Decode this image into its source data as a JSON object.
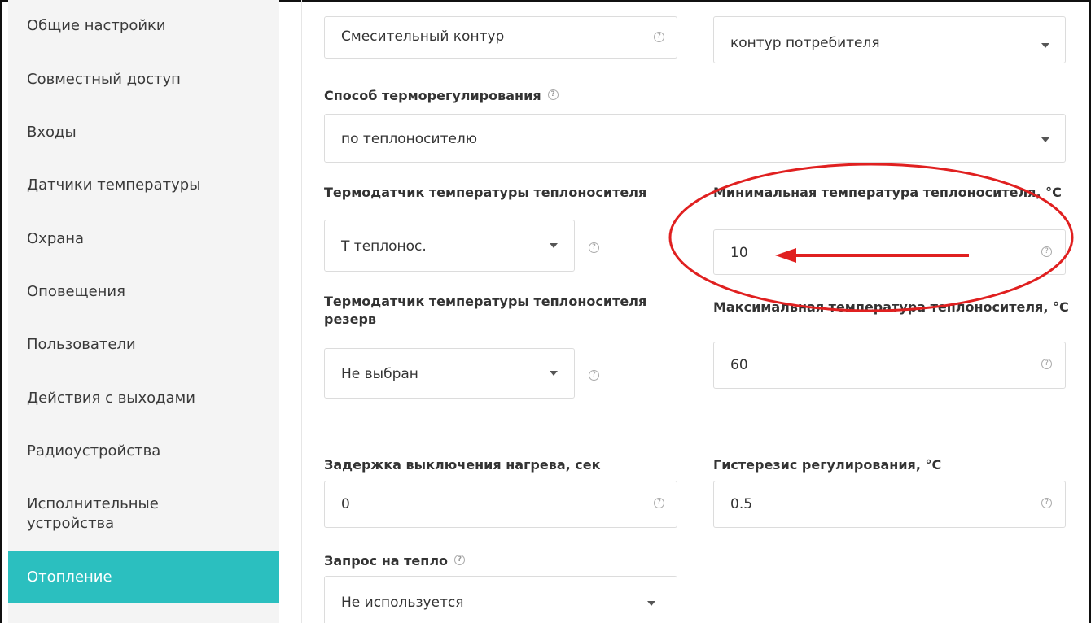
{
  "sidebar": {
    "items": [
      {
        "label": "Общие настройки"
      },
      {
        "label": "Совместный доступ"
      },
      {
        "label": "Входы"
      },
      {
        "label": "Датчики температуры"
      },
      {
        "label": "Охрана"
      },
      {
        "label": "Оповещения"
      },
      {
        "label": "Пользователи"
      },
      {
        "label": "Действия с выходами"
      },
      {
        "label": "Радиоустройства"
      },
      {
        "label": "Исполнительные устройства"
      },
      {
        "label": "Отопление"
      }
    ],
    "active": "Отопление"
  },
  "form": {
    "contour_name": {
      "value": "Смесительный контур"
    },
    "contour_type": {
      "value": "контур потребителя"
    },
    "regulation_method": {
      "label": "Способ терморегулирования",
      "value": "по теплоносителю"
    },
    "coolant_sensor": {
      "label": "Термодатчик температуры теплоносителя",
      "value": "Т теплонос."
    },
    "min_temp": {
      "label": "Минимальная температура теплоносителя, °C",
      "value": "10"
    },
    "coolant_sensor_reserve": {
      "label": "Термодатчик температуры теплоносителя резерв",
      "value": "Не выбран"
    },
    "max_temp": {
      "label": "Максимальная температура теплоносителя, °C",
      "value": "60"
    },
    "heating_off_delay": {
      "label": "Задержка выключения нагрева, сек",
      "value": "0"
    },
    "hysteresis": {
      "label": "Гистерезис регулирования, °C",
      "value": "0.5"
    },
    "heat_request": {
      "label": "Запрос на тепло",
      "value": "Не используется"
    }
  },
  "help_glyph": "?",
  "colors": {
    "accent": "#2bbfbf",
    "annotation": "#e02020"
  }
}
